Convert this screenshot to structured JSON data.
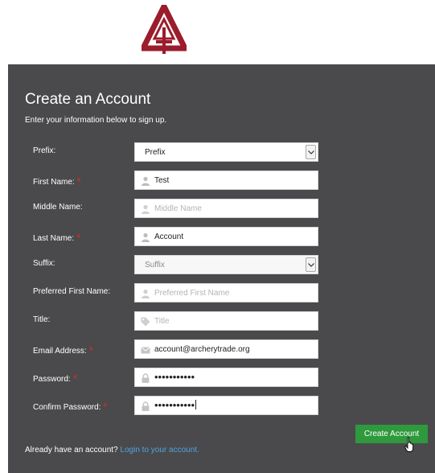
{
  "header": {
    "logo_icon": "archery-trade-logo",
    "brand_color": "#9b1c2c"
  },
  "form": {
    "title": "Create an Account",
    "subtitle": "Enter your information below to sign up.",
    "required_marker": "*",
    "required_color": "#e8262b",
    "fields": {
      "prefix": {
        "label": "Prefix:",
        "value": "Prefix"
      },
      "first_name": {
        "label": "First Name:",
        "value": "Test"
      },
      "middle_name": {
        "label": "Middle Name:",
        "placeholder": "Middle Name"
      },
      "last_name": {
        "label": "Last Name:",
        "value": "Account"
      },
      "suffix": {
        "label": "Suffix:",
        "value": "Suffix"
      },
      "preferred_first_name": {
        "label": "Preferred First Name:",
        "placeholder": "Preferred First Name"
      },
      "title": {
        "label": "Title:",
        "placeholder": "Title"
      },
      "email": {
        "label": "Email Address:",
        "value": "account@archerytrade.org"
      },
      "password": {
        "label": "Password:",
        "value": "•••••••••••"
      },
      "confirm_password": {
        "label": "Confirm Password:",
        "value": "•••••••••••"
      }
    },
    "submit_label": "Create Account",
    "submit_color": "#2e9a3d",
    "footer": {
      "text": "Already have an account?",
      "link": "Login to your account."
    }
  }
}
